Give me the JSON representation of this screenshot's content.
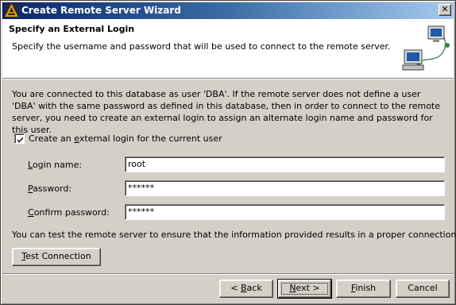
{
  "window": {
    "title": "Create Remote Server Wizard",
    "close_glyph": "✕"
  },
  "header": {
    "title": "Specify an External Login",
    "description": "Specify the username and password that will be used to connect to the remote server.",
    "graphic_icon": "network-computers-icon"
  },
  "intro": {
    "text": "You are connected to this database as user 'DBA'. If the remote server does not define a user 'DBA' with the same password as defined in this database, then in order to connect to the remote server, you need to create an external login to assign an alternate login name and password for this user."
  },
  "checkbox": {
    "label_before": "Create an ",
    "label_mnemonic": "e",
    "label_after": "xternal login for the current user",
    "checked": true
  },
  "fields": {
    "login_name": {
      "label_mnemonic": "L",
      "label_after": "ogin name:",
      "value": "root"
    },
    "password": {
      "label_mnemonic": "P",
      "label_after": "assword:",
      "value": "******"
    },
    "confirm_password": {
      "label_mnemonic": "C",
      "label_after": "onfirm password:",
      "value": "******"
    }
  },
  "note": {
    "text": "You can test the remote server to ensure that the information provided results in a proper connection."
  },
  "buttons": {
    "test_connection": {
      "mnemonic": "T",
      "after": "est Connection"
    },
    "back": {
      "before": "< ",
      "mnemonic": "B",
      "after": "ack"
    },
    "next": {
      "mnemonic": "N",
      "after": "ext >"
    },
    "finish": {
      "mnemonic": "F",
      "after": "inish"
    },
    "cancel": {
      "label": "Cancel"
    }
  }
}
